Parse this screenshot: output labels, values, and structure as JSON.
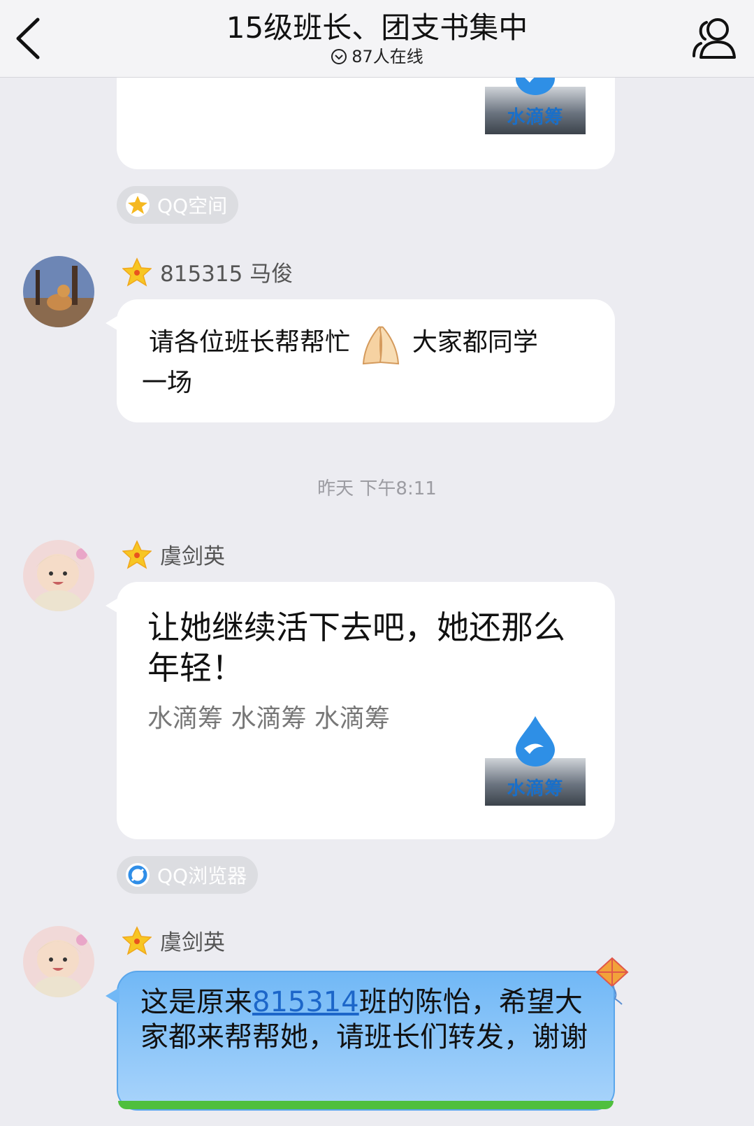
{
  "header": {
    "title": "15级班长、团支书集中",
    "online_count": "87人在线",
    "back_icon": "chevron-left-icon",
    "members_icon": "group-members-icon"
  },
  "messages": [
    {
      "card_logo_label": "水滴筹",
      "source": "QQ空间"
    },
    {
      "sender": "815315 马俊",
      "text_part1": "请各位班长帮帮忙",
      "emoji": "praying-hands",
      "text_part2": "大家都同学",
      "text_line2": "一场"
    },
    {
      "timestamp": "昨天 下午8:11"
    },
    {
      "sender": "虞剑英",
      "title": "让她继续活下去吧，她还那么年轻！",
      "subtitle": "水滴筹 水滴筹 水滴筹",
      "card_logo_label": "水滴筹",
      "source": "QQ浏览器"
    },
    {
      "sender": "虞剑英",
      "text_before": "这是原来",
      "link": "815314",
      "text_after": "班的陈怡，希望大家都来帮帮她，请班长们转发，谢谢"
    }
  ],
  "colors": {
    "background": "#ececf1",
    "link": "#1c66c9",
    "blue_bubble": "#8cc6f9"
  }
}
